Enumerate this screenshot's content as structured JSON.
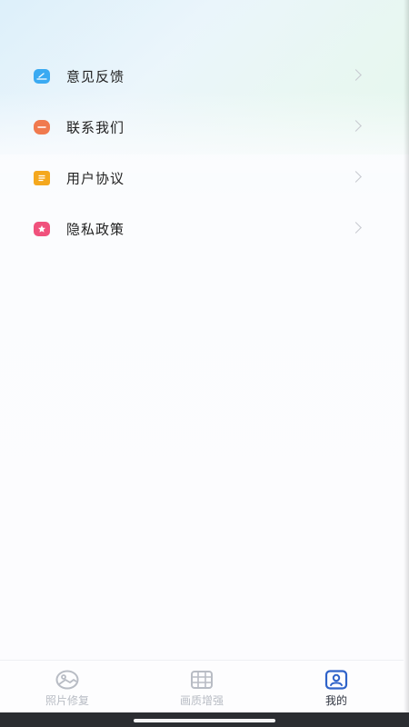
{
  "menu": {
    "items": [
      {
        "label": "意见反馈",
        "icon": "feedback-icon",
        "color": "#3aaaf2"
      },
      {
        "label": "联系我们",
        "icon": "contact-icon",
        "color": "#f07a4e"
      },
      {
        "label": "用户协议",
        "icon": "agreement-icon",
        "color": "#f4a81e"
      },
      {
        "label": "隐私政策",
        "icon": "privacy-icon",
        "color": "#f0517c"
      }
    ]
  },
  "tabbar": {
    "tabs": [
      {
        "label": "照片修复",
        "icon": "photo-icon",
        "active": false
      },
      {
        "label": "画质增强",
        "icon": "film-icon",
        "active": false
      },
      {
        "label": "我的",
        "icon": "profile-icon",
        "active": true
      }
    ],
    "active_color": "#2f63c9",
    "inactive_color": "#b8bcc4"
  }
}
